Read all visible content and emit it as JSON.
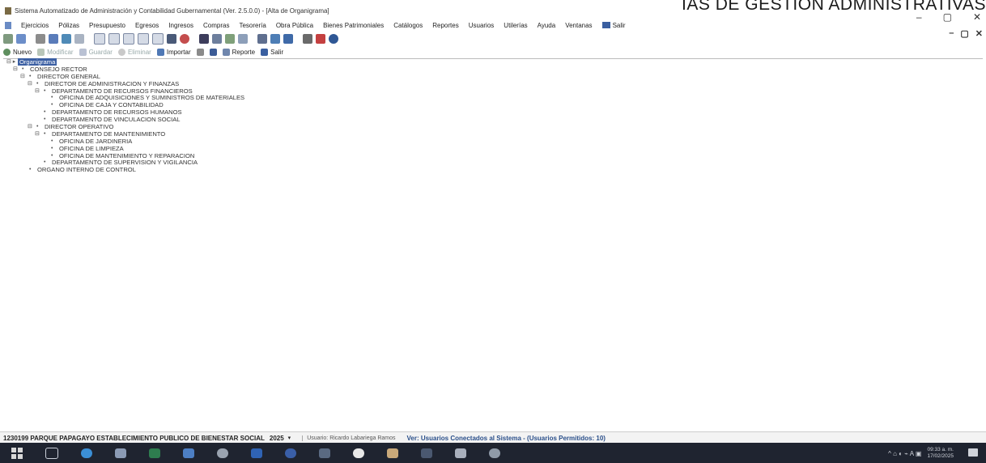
{
  "corner_overlay_text": "IAS DE GESTION ADMINISTRATIVAS",
  "window": {
    "title": "Sistema Automatizado de Administración y Contabilidad Gubernamental  (Ver. 2.5.0.0) - [Alta de Organigrama]",
    "controls": [
      "–",
      "▢",
      "✕"
    ],
    "inner_controls": [
      "–",
      "▢",
      "✕"
    ]
  },
  "menu": {
    "items": [
      "Ejercicios",
      "Pólizas",
      "Presupuesto",
      "Egresos",
      "Ingresos",
      "Compras",
      "Tesorería",
      "Obra Pública",
      "Bienes Patrimoniales",
      "Catálogos",
      "Reportes",
      "Usuarios",
      "Utilerías",
      "Ayuda",
      "Ventanas"
    ],
    "exit_label": "Salir"
  },
  "toolbar_icons": [
    "back-icon",
    "chart-icon",
    "print-icon",
    "filter-icon",
    "grid-icon",
    "table-icon",
    "window-icon",
    "window-icon",
    "window-icon",
    "window-icon",
    "window-icon",
    "record-icon",
    "palette-icon",
    "book-icon",
    "calculator-icon",
    "money-icon",
    "people-icon",
    "signal-icon",
    "tree-icon",
    "sort-icon",
    "lock-icon",
    "disk-icon",
    "help-icon"
  ],
  "actions": {
    "new_label": "Nuevo",
    "modify_label": "Modificar",
    "save_label": "Guardar",
    "delete_label": "Eliminar",
    "import_label": "Importar",
    "report_label": "Reporte",
    "exit_label": "Salir"
  },
  "tree": {
    "root": "Organigrama",
    "nodes": [
      {
        "label": "CONSEJO RECTOR",
        "level": 1,
        "expander": "⊟",
        "bullet": "•"
      },
      {
        "label": "DIRECTOR GENERAL",
        "level": 2,
        "expander": "⊟",
        "bullet": "•"
      },
      {
        "label": "DIRECTOR DE ADMINISTRACION Y FINANZAS",
        "level": 3,
        "expander": "⊟",
        "bullet": "•"
      },
      {
        "label": "DEPARTAMENTO DE RECURSOS FINANCIEROS",
        "level": 4,
        "expander": "⊟",
        "bullet": "•"
      },
      {
        "label": "OFICINA DE ADQUISICIONES Y SUMINISTROS DE MATERIALES",
        "level": 5,
        "expander": "",
        "bullet": "•"
      },
      {
        "label": "OFICINA DE CAJA Y CONTABILIDAD",
        "level": 5,
        "expander": "",
        "bullet": "•"
      },
      {
        "label": "DEPARTAMENTO DE RECURSOS HUMANOS",
        "level": 4,
        "expander": "",
        "bullet": "•"
      },
      {
        "label": "DEPARTAMENTO DE VINCULACION SOCIAL",
        "level": 4,
        "expander": "",
        "bullet": "•"
      },
      {
        "label": "DIRECTOR OPERATIVO",
        "level": 3,
        "expander": "⊟",
        "bullet": "•"
      },
      {
        "label": "DEPARTAMENTO DE MANTENIMIENTO",
        "level": 4,
        "expander": "⊟",
        "bullet": "•"
      },
      {
        "label": "OFICINA DE JARDINERIA",
        "level": 5,
        "expander": "",
        "bullet": "•"
      },
      {
        "label": "OFICINA DE LIMPIEZA",
        "level": 5,
        "expander": "",
        "bullet": "•"
      },
      {
        "label": "OFICINA DE MANTENIMIENTO Y REPARACION",
        "level": 5,
        "expander": "",
        "bullet": "•"
      },
      {
        "label": "DEPARTAMENTO DE SUPERVISION Y VIGILANCIA",
        "level": 4,
        "expander": "",
        "bullet": "•"
      },
      {
        "label": "ORGANO INTERNO DE CONTROL",
        "level": 2,
        "expander": "",
        "bullet": "•"
      }
    ]
  },
  "status": {
    "entity": "1230199 PARQUE PAPAGAYO ESTABLECIMIENTO PUBLICO DE BIENESTAR SOCIAL",
    "year": "2025",
    "arrow": "▾",
    "user": "Usuario: Ricardo Labariega Ramos",
    "connected": "Ver: Usuarios Conectados al Sistema - (Usuarios Permitidos: 10)"
  },
  "taskbar": {
    "tray_icons": "^  ⌂  ◐  ⌁  A  ▣",
    "time": "09:33 a. m.",
    "date": "17/02/2025"
  }
}
